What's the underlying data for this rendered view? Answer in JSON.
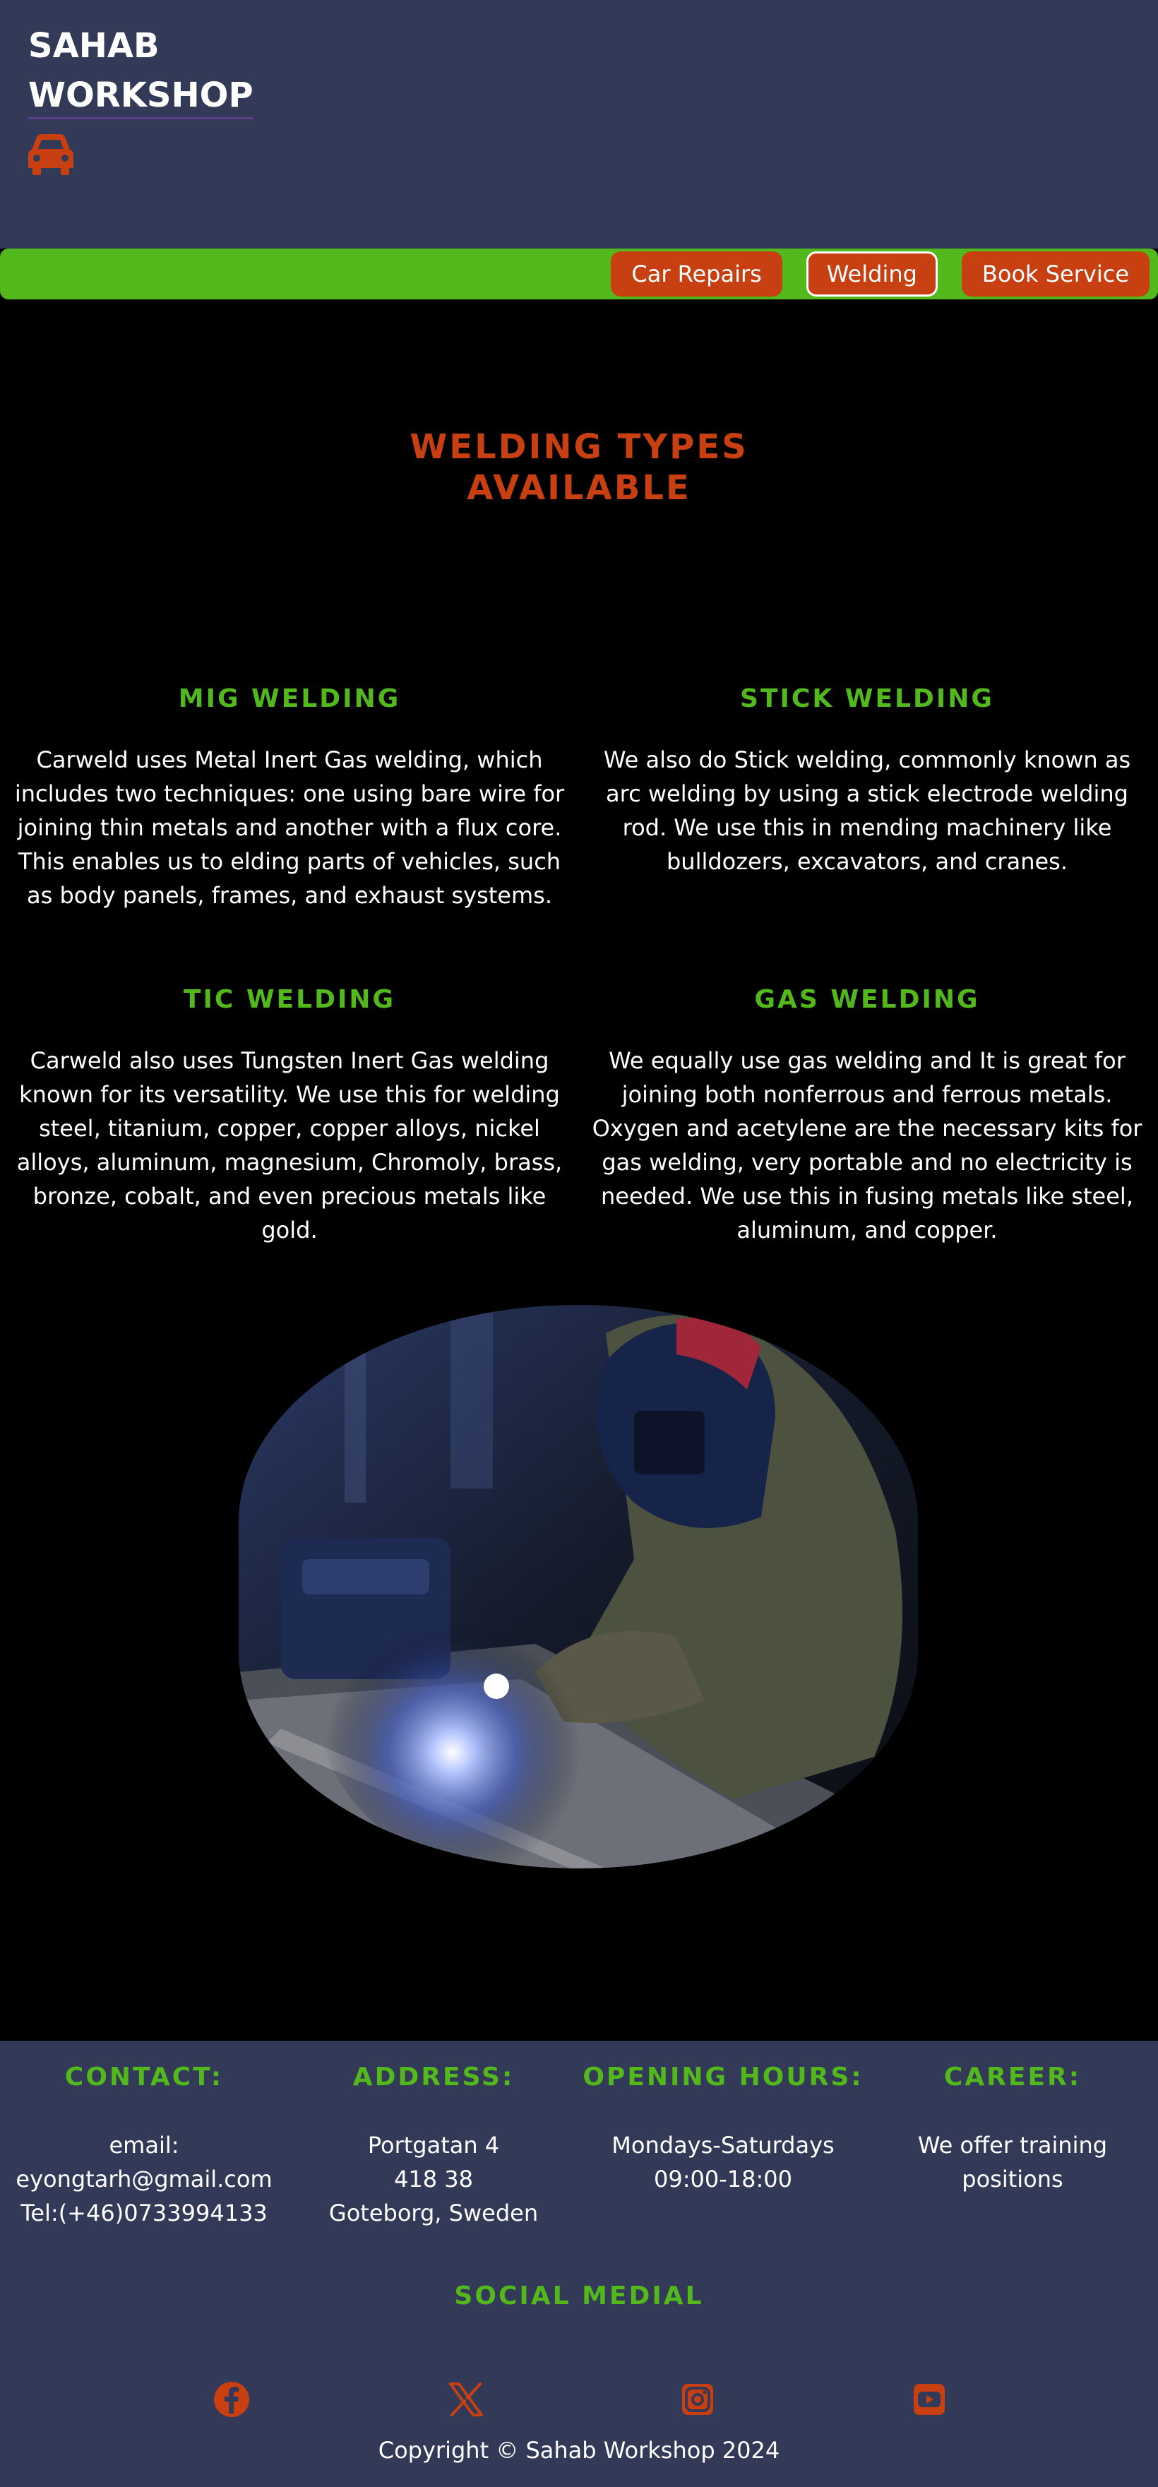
{
  "brand": {
    "line1": "SAHAB",
    "line2": "WORKSHOP",
    "icon": "car-icon"
  },
  "nav": {
    "items": [
      {
        "label": "Car Repairs"
      },
      {
        "label": "Welding",
        "active": true
      },
      {
        "label": "Book Service"
      }
    ]
  },
  "main": {
    "title_line1": "WELDING TYPES",
    "title_line2": "AVAILABLE",
    "cards": [
      {
        "title": "MIG WELDING",
        "text": "Carweld uses Metal Inert Gas welding, which includes two techniques: one using bare wire for joining thin metals and another with a flux core. This enables us to elding parts of vehicles, such as body panels, frames, and exhaust systems."
      },
      {
        "title": "STICK WELDING",
        "text": "We also do Stick welding, commonly known as arc welding by using a stick electrode welding rod. We use this in mending machinery like bulldozers, excavators, and cranes."
      },
      {
        "title": "TIC WELDING",
        "text": "Carweld also uses Tungsten Inert Gas welding known for its versatility. We use this for welding steel, titanium, copper, copper alloys, nickel alloys, aluminum, magnesium, Chromoly, brass, bronze, cobalt, and even precious metals like gold."
      },
      {
        "title": "GAS WELDING",
        "text": "We equally use gas welding and It is great for joining both nonferrous and ferrous metals. Oxygen and acetylene are the necessary kits for gas welding, very portable and no electricity is needed. We use this in fusing metals like steel, aluminum, and copper."
      }
    ]
  },
  "footer": {
    "contact": {
      "title": "CONTACT:",
      "line1": "email:",
      "line2": "eyongtarh@gmail.com",
      "line3": "Tel:(+46)0733994133"
    },
    "address": {
      "title": "ADDRESS:",
      "line1": "Portgatan 4",
      "line2": "418 38",
      "line3": "Goteborg, Sweden"
    },
    "hours": {
      "title": "OPENING HOURS:",
      "line1": "Mondays-Saturdays",
      "line2": "09:00-18:00"
    },
    "career": {
      "title": "CAREER:",
      "line1": "We offer training",
      "line2": "positions"
    },
    "social_title": "SOCIAL MEDIAL",
    "social_icons": [
      "facebook-icon",
      "x-icon",
      "instagram-icon",
      "youtube-icon"
    ],
    "copyright": "Copyright © Sahab Workshop 2024"
  },
  "colors": {
    "header_bg": "#323a57",
    "accent_orange": "#c84011",
    "accent_green": "#52b81b"
  }
}
